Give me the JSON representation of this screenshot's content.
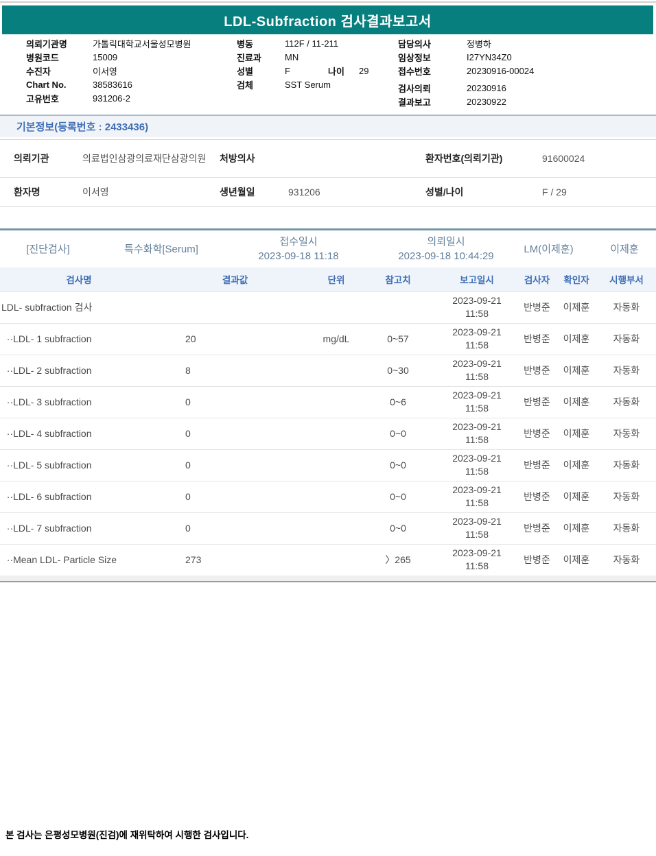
{
  "title": "LDL-Subfraction 검사결과보고서",
  "header_info": {
    "col1": [
      {
        "label": "의뢰기관명",
        "value": "가톨릭대학교서울성모병원"
      },
      {
        "label": "병원코드",
        "value": "15009"
      },
      {
        "label": "수진자",
        "value": "이서영"
      },
      {
        "label": "Chart No.",
        "value": "38583616"
      },
      {
        "label": "고유번호",
        "value": "931206-2"
      }
    ],
    "col2": [
      {
        "label": "병동",
        "value": "112F / 11-211"
      },
      {
        "label": "진료과",
        "value": "MN"
      },
      {
        "label": "성별",
        "value": "F",
        "label2": "나이",
        "value2": "29"
      },
      {
        "label": "검체",
        "value": "SST Serum"
      }
    ],
    "col3": [
      {
        "label": "담당의사",
        "value": "정병하"
      },
      {
        "label": "임상정보",
        "value": "I27YN34Z0"
      },
      {
        "label": "접수번호",
        "value": "20230916-00024"
      },
      {
        "label": "검사의뢰",
        "value": "20230916"
      },
      {
        "label": "결과보고",
        "value": "20230922"
      }
    ]
  },
  "basic_info": {
    "heading": "기본정보(등록번호 : 2433436)"
  },
  "patient": {
    "org_label": "의뢰기관",
    "org_value": "의료법인삼광의료재단삼광의원",
    "doctor_label": "처방의사",
    "doctor_value": "",
    "patno_label": "환자번호(의뢰기관)",
    "patno_value": "91600024",
    "name_label": "환자명",
    "name_value": "이서영",
    "birth_label": "생년월일",
    "birth_value": "931206",
    "sexage_label": "성별/나이",
    "sexage_value": "F / 29"
  },
  "section_band": {
    "category_bracket": "[진단검사]",
    "test_group": "특수화학[Serum]",
    "receipt_label": "접수일시",
    "receipt_datetime": "2023-09-18 11:18",
    "request_label": "의뢰일시",
    "request_datetime": "2023-09-18 10:44:29",
    "lab_physician": "LM(이제훈)",
    "confirmed_by": "이제훈"
  },
  "results": {
    "headers": [
      "검사명",
      "결과값",
      "단위",
      "참고치",
      "보고일시",
      "검사자",
      "확인자",
      "시행부서"
    ],
    "rows": [
      {
        "name": "LDL- subfraction 검사",
        "result": "",
        "unit": "",
        "ref": "",
        "report_date": "2023-09-21",
        "report_time": "11:58",
        "tester": "반병준",
        "confirmer": "이제훈",
        "dept": "자동화"
      },
      {
        "name": "  ··LDL- 1 subfraction",
        "result": "20",
        "unit": "mg/dL",
        "ref": "0~57",
        "report_date": "2023-09-21",
        "report_time": "11:58",
        "tester": "반병준",
        "confirmer": "이제훈",
        "dept": "자동화"
      },
      {
        "name": "  ··LDL- 2 subfraction",
        "result": "8",
        "unit": "",
        "ref": "0~30",
        "report_date": "2023-09-21",
        "report_time": "11:58",
        "tester": "반병준",
        "confirmer": "이제훈",
        "dept": "자동화"
      },
      {
        "name": "  ··LDL- 3 subfraction",
        "result": "0",
        "unit": "",
        "ref": "0~6",
        "report_date": "2023-09-21",
        "report_time": "11:58",
        "tester": "반병준",
        "confirmer": "이제훈",
        "dept": "자동화"
      },
      {
        "name": "  ··LDL- 4 subfraction",
        "result": "0",
        "unit": "",
        "ref": "0~0",
        "report_date": "2023-09-21",
        "report_time": "11:58",
        "tester": "반병준",
        "confirmer": "이제훈",
        "dept": "자동화"
      },
      {
        "name": "  ··LDL- 5 subfraction",
        "result": "0",
        "unit": "",
        "ref": "0~0",
        "report_date": "2023-09-21",
        "report_time": "11:58",
        "tester": "반병준",
        "confirmer": "이제훈",
        "dept": "자동화"
      },
      {
        "name": "  ··LDL- 6 subfraction",
        "result": "0",
        "unit": "",
        "ref": "0~0",
        "report_date": "2023-09-21",
        "report_time": "11:58",
        "tester": "반병준",
        "confirmer": "이제훈",
        "dept": "자동화"
      },
      {
        "name": "  ··LDL- 7 subfraction",
        "result": "0",
        "unit": "",
        "ref": "0~0",
        "report_date": "2023-09-21",
        "report_time": "11:58",
        "tester": "반병준",
        "confirmer": "이제훈",
        "dept": "자동화"
      },
      {
        "name": "  ··Mean LDL- Particle Size",
        "result": "273",
        "unit": "",
        "ref": "〉265",
        "report_date": "2023-09-21",
        "report_time": "11:58",
        "tester": "반병준",
        "confirmer": "이제훈",
        "dept": "자동화"
      }
    ]
  },
  "footer": {
    "note": "본 검사는 은평성모병원(진검)에 재위탁하여 시행한 검사입니다."
  },
  "colors": {
    "header_teal": "#077f7f",
    "accent_blue": "#3e6db5",
    "band_text": "#64809c",
    "divider_steel": "#7596a8",
    "table_header_bg": "#eef4fa"
  }
}
